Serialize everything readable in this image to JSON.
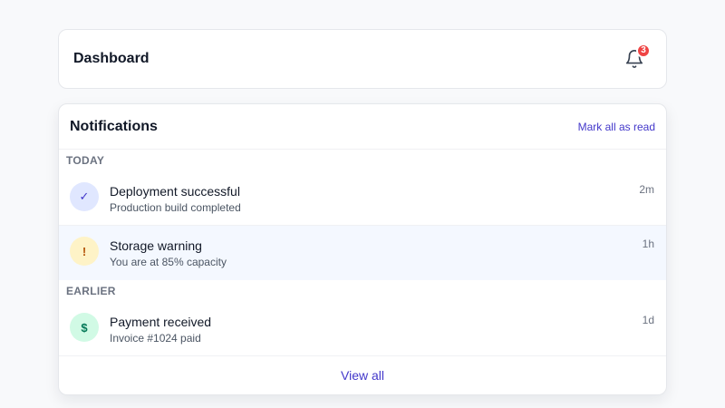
{
  "header": {
    "title": "Dashboard",
    "notification_count": "3",
    "bell_icon": "bell-icon"
  },
  "panel": {
    "title": "Notifications",
    "mark_all_label": "Mark all as read",
    "groups": [
      {
        "label": "TODAY",
        "items": [
          {
            "icon": "check-icon",
            "glyph": "✓",
            "icon_bg": "#e0e7ff",
            "icon_color": "#4338ca",
            "title": "Deployment successful",
            "subtitle": "Production build completed",
            "time": "2m"
          },
          {
            "icon": "warning-icon",
            "glyph": "!",
            "icon_bg": "#fef3c7",
            "icon_color": "#b45309",
            "title": "Storage warning",
            "subtitle": "You are at 85% capacity",
            "time": "1h"
          }
        ]
      },
      {
        "label": "EARLIER",
        "items": [
          {
            "icon": "dollar-icon",
            "glyph": "$",
            "icon_bg": "#d1fae5",
            "icon_color": "#047857",
            "title": "Payment received",
            "subtitle": "Invoice #1024 paid",
            "time": "1d"
          }
        ]
      }
    ],
    "view_all_label": "View all"
  },
  "colors": {
    "accent": "#4338ca",
    "badge": "#ef4444",
    "highlight_row": "#f4f8ff"
  }
}
